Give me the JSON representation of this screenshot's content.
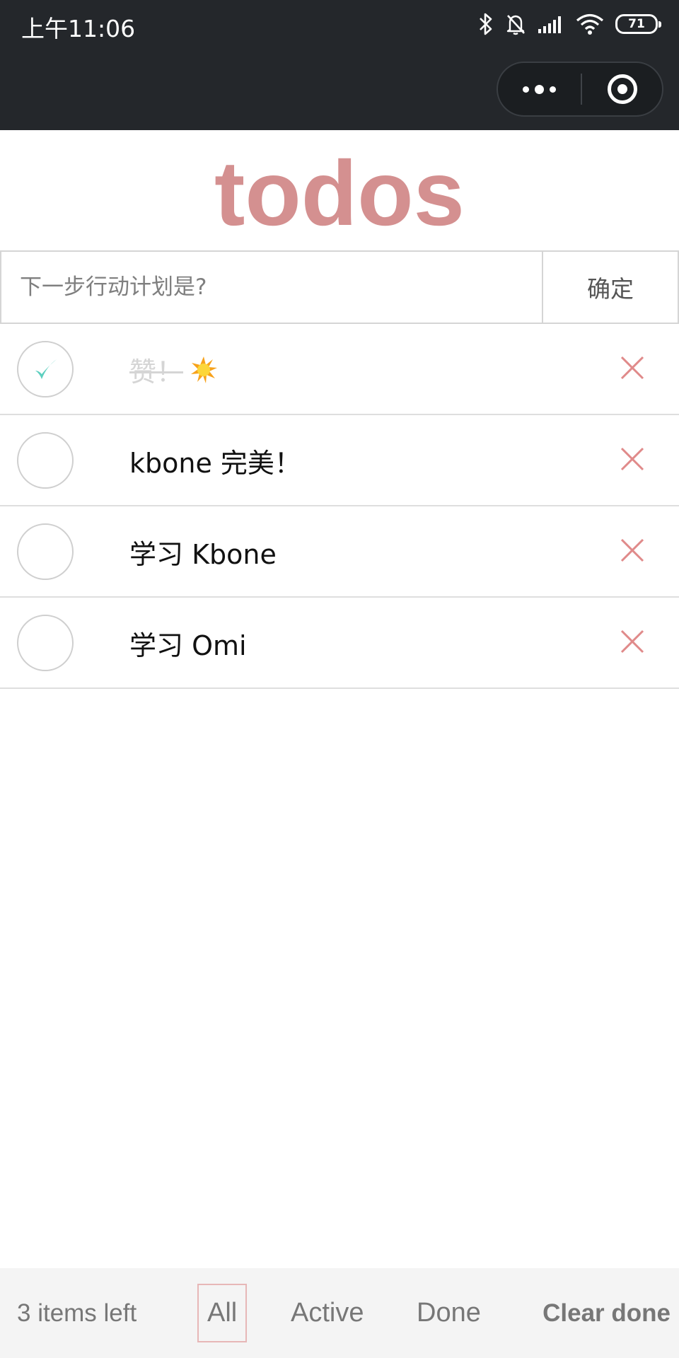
{
  "status_bar": {
    "time": "上午11:06",
    "battery": "71",
    "icons": [
      "bluetooth-icon",
      "bell-off-icon",
      "signal-icon",
      "wifi-icon",
      "battery-icon"
    ]
  },
  "header": {
    "menu_icon": "more-dots-icon",
    "close_icon": "target-icon"
  },
  "app": {
    "title": "todos",
    "accent_color": "#d49090"
  },
  "new_todo": {
    "placeholder": "下一步行动计划是?",
    "value": "",
    "confirm_label": "确定"
  },
  "todos": [
    {
      "text": "赞！",
      "done": true,
      "emoji": "sun-emoji"
    },
    {
      "text": "kbone 完美！",
      "done": false
    },
    {
      "text": "学习 Kbone",
      "done": false
    },
    {
      "text": "学习 Omi",
      "done": false
    }
  ],
  "footer": {
    "items_left": "3 items left",
    "filters": [
      "All",
      "Active",
      "Done"
    ],
    "selected_filter": "All",
    "clear_label": "Clear done"
  }
}
